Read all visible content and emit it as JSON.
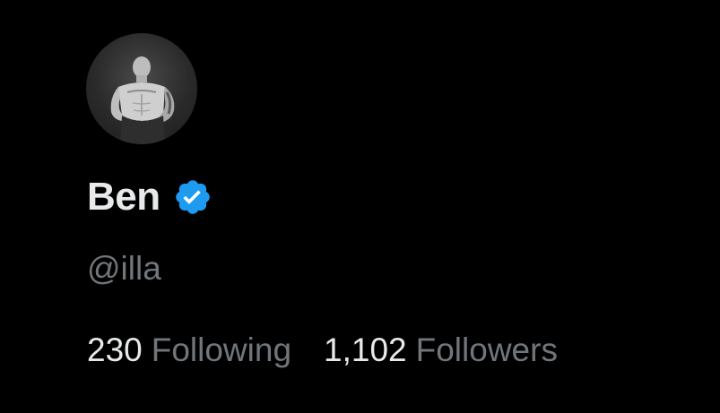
{
  "profile": {
    "display_name": "Ben",
    "handle": "@illa",
    "verified": true,
    "avatar_description_icon": "avatar-photo",
    "colors": {
      "background": "#000000",
      "primary_text": "#e7e9ea",
      "secondary_text": "#71767b",
      "verified_badge": "#1d9bf0"
    }
  },
  "stats": {
    "following_count": "230",
    "following_label": "Following",
    "followers_count": "1,102",
    "followers_label": "Followers"
  }
}
